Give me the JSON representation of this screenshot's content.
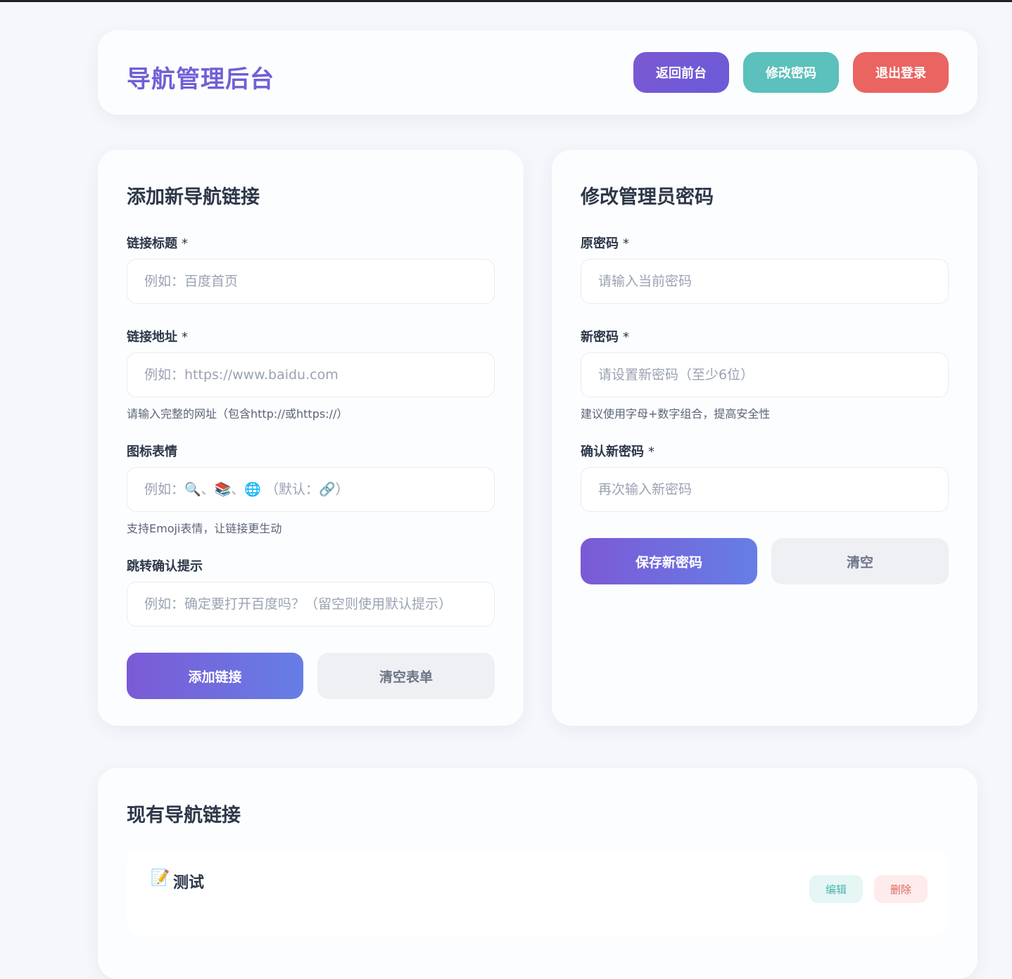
{
  "header": {
    "title": "导航管理后台",
    "buttons": {
      "front": "返回前台",
      "change_password": "修改密码",
      "logout": "退出登录"
    }
  },
  "add_form": {
    "title": "添加新导航链接",
    "link_title": {
      "label": "链接标题",
      "required_mark": "*",
      "placeholder": "例如：百度首页"
    },
    "link_url": {
      "label": "链接地址",
      "required_mark": "*",
      "placeholder": "例如：https://www.baidu.com",
      "hint": "请输入完整的网址（包含http://或https://）"
    },
    "icon": {
      "label": "图标表情",
      "placeholder": "例如：🔍、📚、🌐 （默认：🔗）",
      "hint": "支持Emoji表情，让链接更生动"
    },
    "confirm_text": {
      "label": "跳转确认提示",
      "placeholder": "例如：确定要打开百度吗？（留空则使用默认提示）"
    },
    "submit_label": "添加链接",
    "reset_label": "清空表单"
  },
  "password_form": {
    "title": "修改管理员密码",
    "old_password": {
      "label": "原密码",
      "required_mark": "*",
      "placeholder": "请输入当前密码"
    },
    "new_password": {
      "label": "新密码",
      "required_mark": "*",
      "placeholder": "请设置新密码（至少6位）",
      "hint": "建议使用字母+数字组合，提高安全性"
    },
    "confirm_password": {
      "label": "确认新密码",
      "required_mark": "*",
      "placeholder": "再次输入新密码"
    },
    "submit_label": "保存新密码",
    "reset_label": "清空"
  },
  "links": {
    "title": "现有导航链接",
    "items": [
      {
        "icon": "📝",
        "title": "测试",
        "edit_label": "编辑",
        "delete_label": "删除"
      }
    ]
  },
  "colors": {
    "accent": "#6f5fd6",
    "teal": "#5cc0bc",
    "danger": "#ea6461",
    "background": "#f5f7fb"
  }
}
